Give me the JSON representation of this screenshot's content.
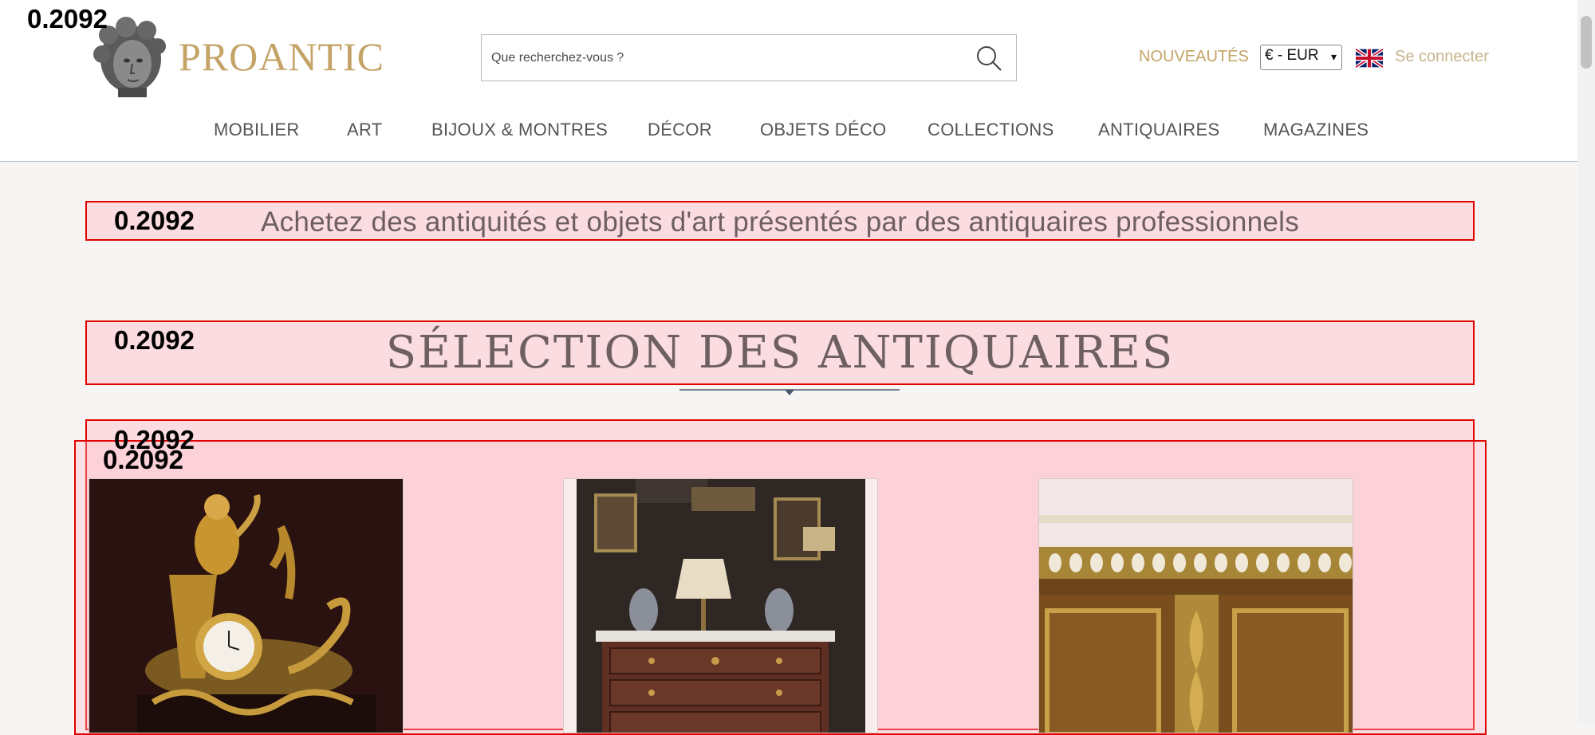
{
  "header": {
    "logo_text": "PROANTIC",
    "search_placeholder": "Que recherchez-vous ?",
    "nouveautes": "NOUVEAUTÉS",
    "currency": "€ - EUR",
    "login": "Se connecter"
  },
  "nav": {
    "items": [
      {
        "label": "MOBILIER"
      },
      {
        "label": "ART"
      },
      {
        "label": "BIJOUX & MONTRES"
      },
      {
        "label": "DÉCOR"
      },
      {
        "label": "OBJETS DÉCO"
      },
      {
        "label": "COLLECTIONS"
      },
      {
        "label": "ANTIQUAIRES"
      },
      {
        "label": "MAGAZINES"
      }
    ]
  },
  "main": {
    "tagline": "Achetez des antiquités et objets d'art présentés par des antiquaires professionnels",
    "section_title": "SÉLECTION DES ANTIQUAIRES"
  },
  "overlay": {
    "scores": [
      "0.2092",
      "0.2092",
      "0.2092",
      "0.2092",
      "0.2092"
    ]
  },
  "colors": {
    "gold": "#c3a366",
    "highlight_border": "#e10000",
    "title_text": "#6e5f63"
  }
}
